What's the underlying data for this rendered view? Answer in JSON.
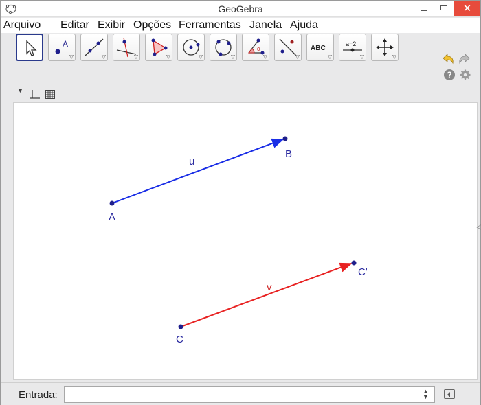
{
  "window": {
    "title": "GeoGebra"
  },
  "menu": {
    "items": [
      "Arquivo",
      "Editar",
      "Exibir",
      "Opções",
      "Ferramentas",
      "Janela",
      "Ajuda"
    ]
  },
  "toolbar": {
    "tools": [
      {
        "name": "move-tool",
        "icon": "pointer-arrow-icon",
        "selected": true
      },
      {
        "name": "point-tool",
        "icon": "point-icon",
        "label": "A"
      },
      {
        "name": "line-tool",
        "icon": "line-two-points-icon"
      },
      {
        "name": "perpendicular-line-tool",
        "icon": "perpendicular-line-icon"
      },
      {
        "name": "polygon-tool",
        "icon": "polygon-icon"
      },
      {
        "name": "circle-tool",
        "icon": "circle-center-point-icon"
      },
      {
        "name": "circle-three-points-tool",
        "icon": "circle-three-points-icon"
      },
      {
        "name": "angle-tool",
        "icon": "angle-icon",
        "label": "α"
      },
      {
        "name": "reflect-tool",
        "icon": "reflect-about-line-icon"
      },
      {
        "name": "text-tool",
        "icon": "text-icon",
        "label": "ABC"
      },
      {
        "name": "slider-tool",
        "icon": "slider-icon",
        "label": "a=2"
      },
      {
        "name": "move-view-tool",
        "icon": "move-graphics-view-icon"
      }
    ]
  },
  "graphics": {
    "points": {
      "A": "A",
      "B": "B",
      "C": "C",
      "C_prime": "C'"
    },
    "vectors": {
      "u": "u",
      "v": "v"
    },
    "colors": {
      "point": "#1f1f8c",
      "vector_u": "#1a2ee6",
      "vector_v": "#e82222",
      "label_u": "#2b2ba0",
      "label_v": "#d03030"
    }
  },
  "inputbar": {
    "label": "Entrada:",
    "value": "",
    "placeholder": ""
  }
}
